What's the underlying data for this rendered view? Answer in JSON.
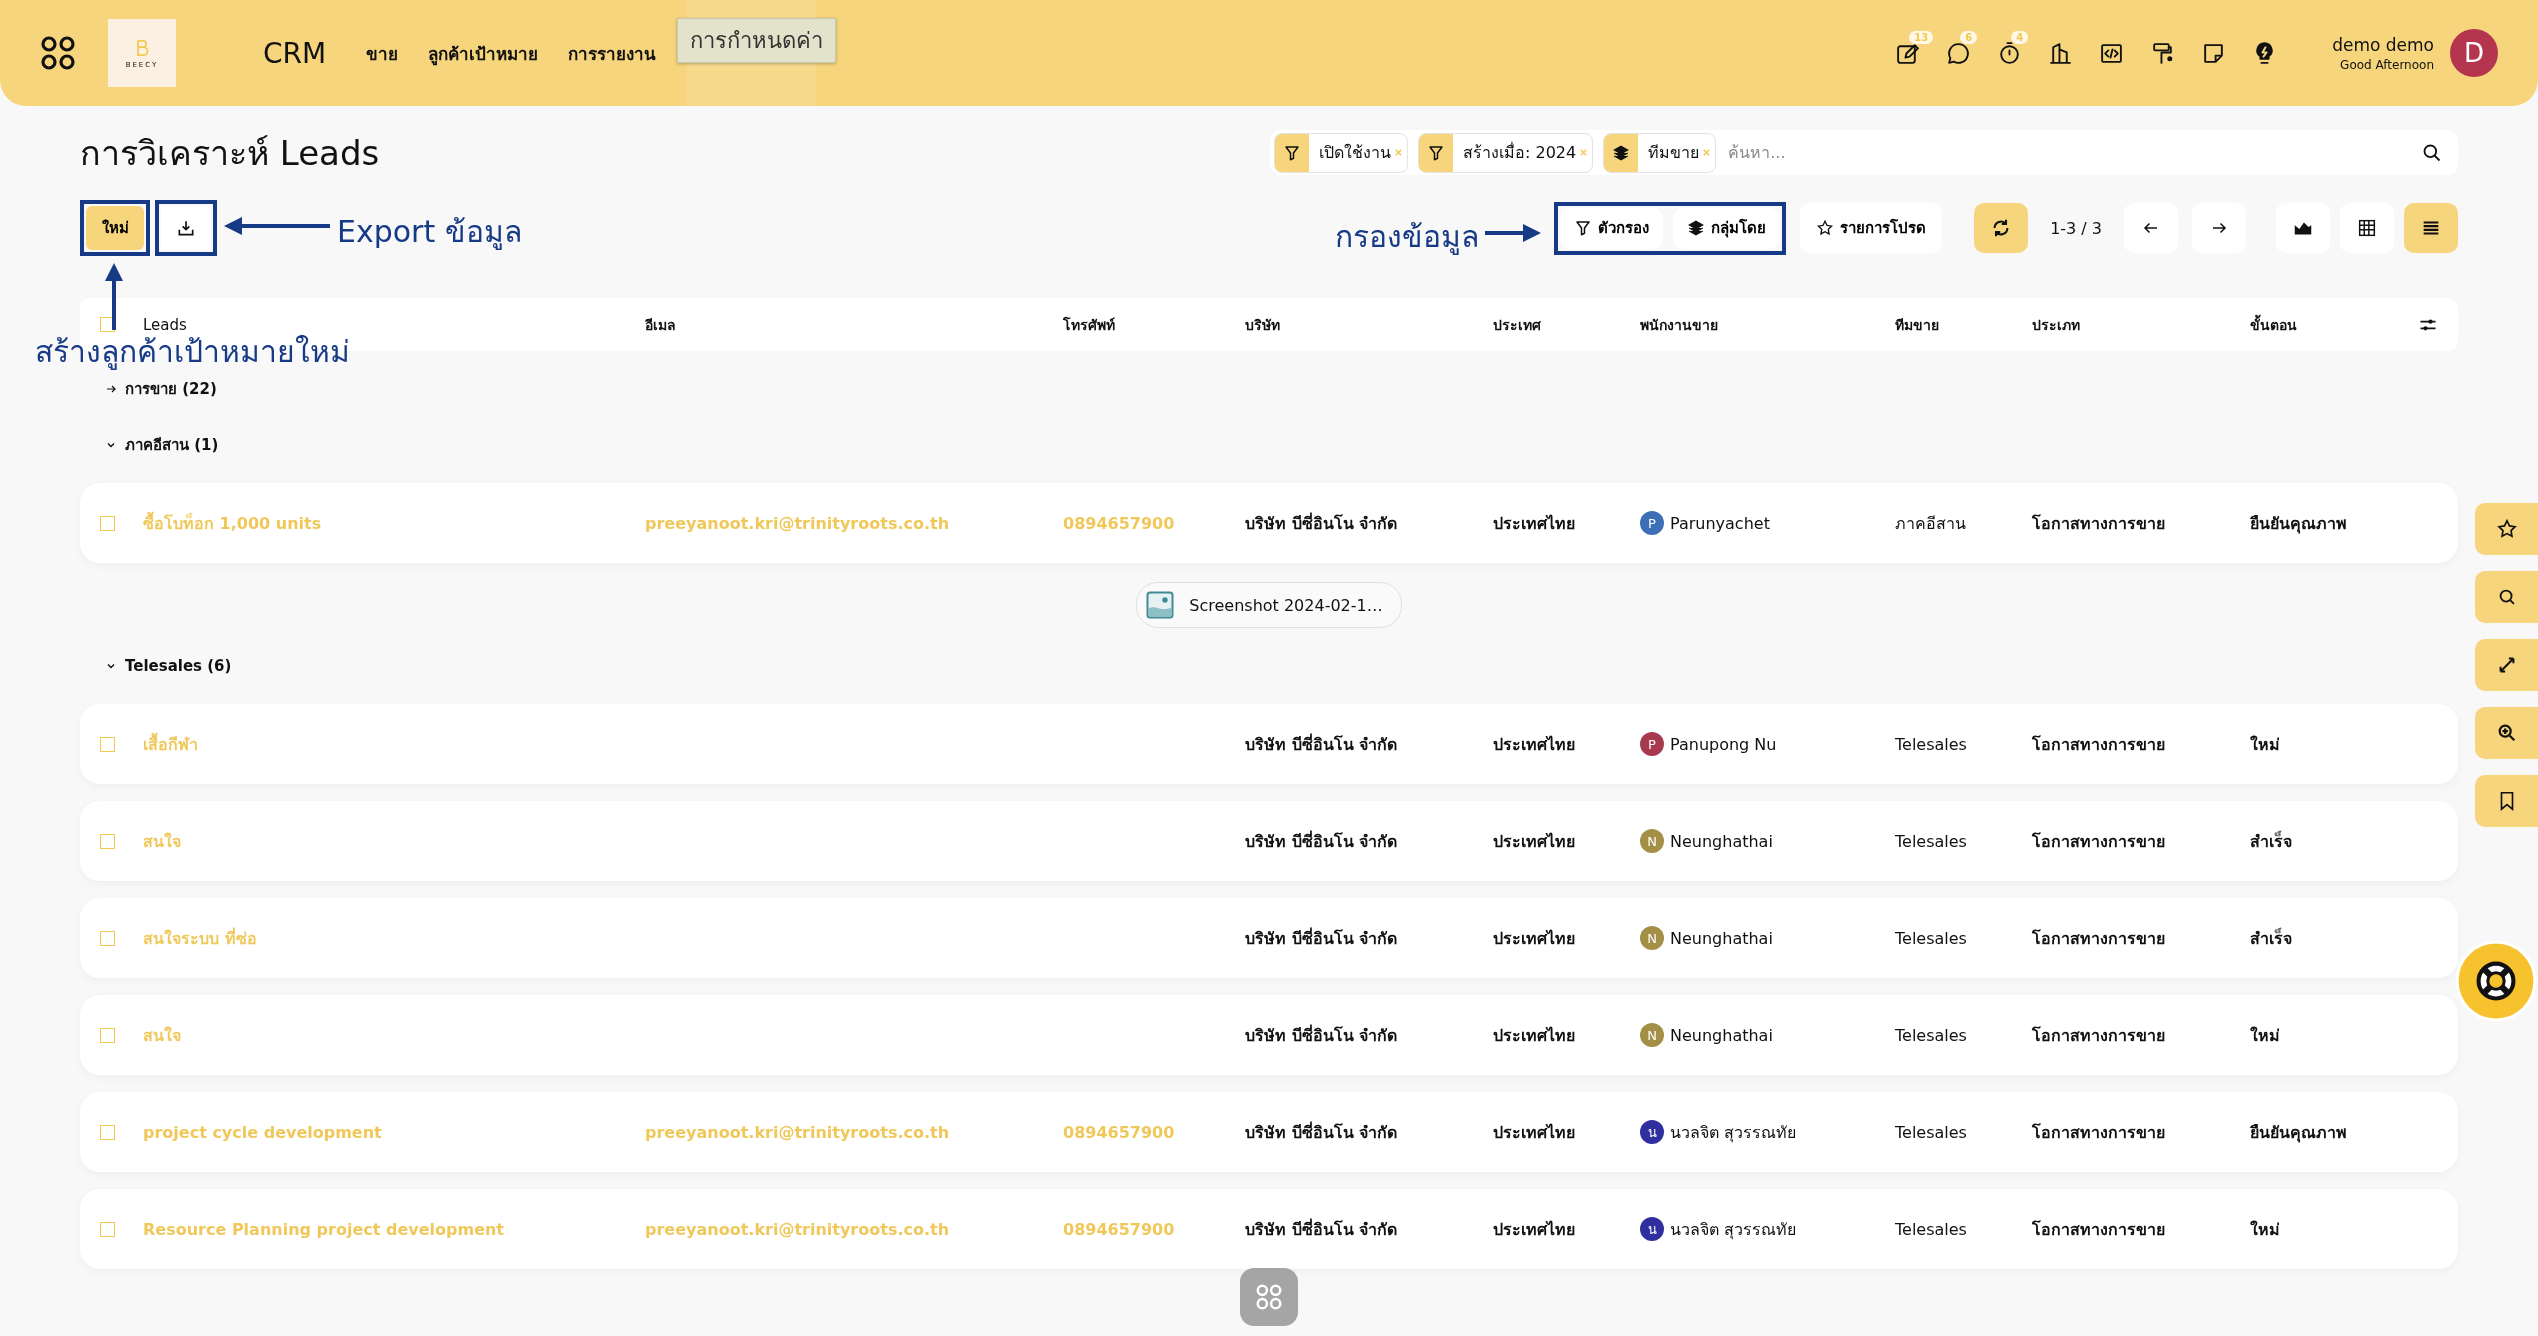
{
  "header": {
    "logo_text": "BEECY",
    "brand": "CRM",
    "nav": [
      {
        "label": "ขาย"
      },
      {
        "label": "ลูกค้าเป้าหมาย"
      },
      {
        "label": "การรายงาน"
      }
    ],
    "tooltip": "การกำหนดค่า",
    "icons": [
      {
        "kind": "note-edit",
        "badge": "13"
      },
      {
        "kind": "chat",
        "badge": "6"
      },
      {
        "kind": "timer",
        "badge": "4"
      },
      {
        "kind": "building"
      },
      {
        "kind": "code"
      },
      {
        "kind": "paint"
      },
      {
        "kind": "sticky"
      },
      {
        "kind": "bulb"
      }
    ],
    "user": {
      "name": "demo demo",
      "greeting": "Good Afternoon",
      "initial": "D"
    }
  },
  "page_title": "การวิเคราะห์ Leads",
  "new_button": "ใหม่",
  "search": {
    "facets": [
      {
        "kind": "filter",
        "label": "เปิดใช้งาน"
      },
      {
        "kind": "filter",
        "label": "สร้างเมื่อ: 2024"
      },
      {
        "kind": "group",
        "label": "ทีมขาย"
      }
    ],
    "placeholder": "ค้นหา..."
  },
  "toolbar": {
    "filter": "ตัวกรอง",
    "group_by": "กลุ่มโดย",
    "favorites": "รายการโปรด",
    "pager": "1-3 / 3",
    "views": [
      {
        "kind": "graph",
        "selected": false
      },
      {
        "kind": "pivot",
        "selected": false
      },
      {
        "kind": "list",
        "selected": true
      }
    ]
  },
  "table": {
    "select_all": {
      "checked": false
    },
    "columns": [
      "Leads",
      "อีเมล",
      "โทรศัพท์",
      "บริษัท",
      "ประเทศ",
      "พนักงานขาย",
      "ทีมขาย",
      "ประเภท",
      "ขั้นตอน"
    ],
    "groups": [
      {
        "label": "การขาย (22)",
        "expanded": false
      },
      {
        "label": "ภาคอีสาน (1)",
        "expanded": true,
        "rows": [
          {
            "checked": false,
            "name": "ซื้อโบท็อก 1,000 units",
            "email": "preeyanoot.kri@trinityroots.co.th",
            "phone": "0894657900",
            "company": "บริษัท บีซี่อินโน จำกัด",
            "country": "ประเทศไทย",
            "salesperson": {
              "initial": "P",
              "name": "Parunyachet",
              "color": "#3d6fb6"
            },
            "team": "ภาคอีสาน",
            "type": "โอกาสทางการขาย",
            "stage": "ยืนยันคุณภาพ"
          }
        ]
      },
      {
        "label": "Telesales (6)",
        "expanded": true,
        "rows": [
          {
            "checked": false,
            "name": "เสื้อกีฬา",
            "company": "บริษัท บีซี่อินโน จำกัด",
            "country": "ประเทศไทย",
            "salesperson": {
              "initial": "P",
              "name": "Panupong Nu",
              "color": "#a83a50"
            },
            "team": "Telesales",
            "type": "โอกาสทางการขาย",
            "stage": "ใหม่"
          },
          {
            "checked": false,
            "name": "สนใจ",
            "company": "บริษัท บีซี่อินโน จำกัด",
            "country": "ประเทศไทย",
            "salesperson": {
              "initial": "N",
              "name": "Neunghathai",
              "color": "#a38f45"
            },
            "team": "Telesales",
            "type": "โอกาสทางการขาย",
            "stage": "สำเร็จ"
          },
          {
            "checked": false,
            "name": "สนใจระบบ ที่ซ่อ",
            "company": "บริษัท บีซี่อินโน จำกัด",
            "country": "ประเทศไทย",
            "salesperson": {
              "initial": "N",
              "name": "Neunghathai",
              "color": "#a38f45"
            },
            "team": "Telesales",
            "type": "โอกาสทางการขาย",
            "stage": "สำเร็จ"
          },
          {
            "checked": false,
            "name": "สนใจ",
            "company": "บริษัท บีซี่อินโน จำกัด",
            "country": "ประเทศไทย",
            "salesperson": {
              "initial": "N",
              "name": "Neunghathai",
              "color": "#a38f45"
            },
            "team": "Telesales",
            "type": "โอกาสทางการขาย",
            "stage": "ใหม่"
          },
          {
            "checked": false,
            "name": "project cycle development",
            "email": "preeyanoot.kri@trinityroots.co.th",
            "phone": "0894657900",
            "company": "บริษัท บีซี่อินโน จำกัด",
            "country": "ประเทศไทย",
            "salesperson": {
              "initial": "น",
              "name": "นวลจิต สุวรรณทัย",
              "color": "#2f2fa0"
            },
            "team": "Telesales",
            "type": "โอกาสทางการขาย",
            "stage": "ยืนยันคุณภาพ"
          },
          {
            "checked": false,
            "name": "Resource Planning project development",
            "email": "preeyanoot.kri@trinityroots.co.th",
            "phone": "0894657900",
            "company": "บริษัท บีซี่อินโน จำกัด",
            "country": "ประเทศไทย",
            "salesperson": {
              "initial": "น",
              "name": "นวลจิต สุวรรณทัย",
              "color": "#2f2fa0"
            },
            "team": "Telesales",
            "type": "โอกาสทางการขาย",
            "stage": "ใหม่"
          }
        ]
      }
    ]
  },
  "attachment": {
    "label": "Screenshot 2024-02-1…"
  },
  "side_buttons": [
    {
      "kind": "star"
    },
    {
      "kind": "search"
    },
    {
      "kind": "expand"
    },
    {
      "kind": "zoom"
    },
    {
      "kind": "bookmark"
    }
  ],
  "annotations": [
    {
      "kind": "export",
      "text": "Export ข้อมูล"
    },
    {
      "kind": "new",
      "text": "สร้างลูกค้าเป้าหมายใหม่"
    },
    {
      "kind": "filter",
      "text": "กรองข้อมูล"
    }
  ]
}
